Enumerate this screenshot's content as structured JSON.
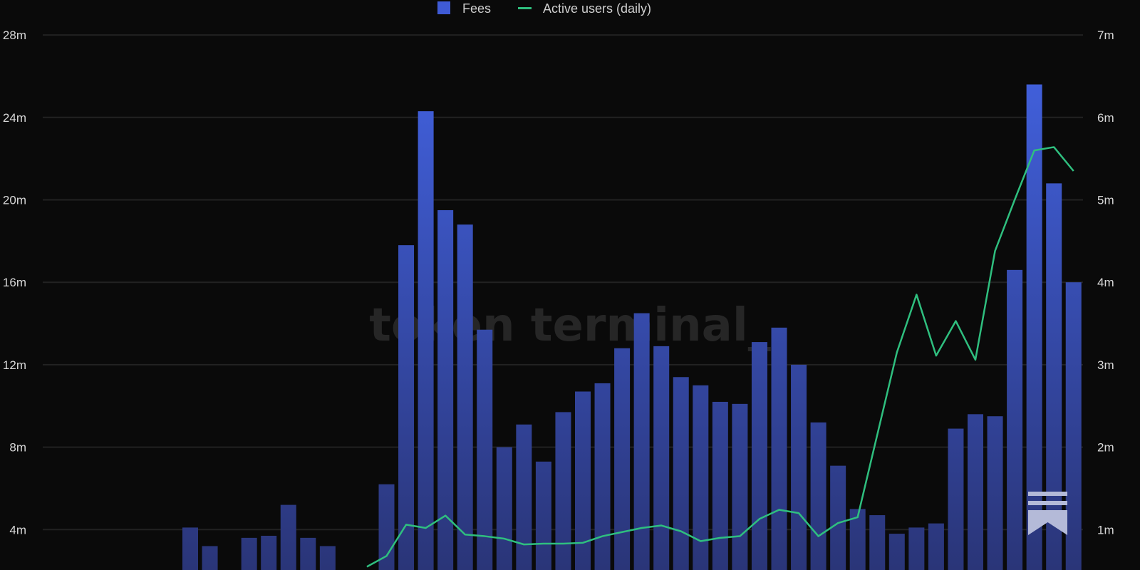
{
  "chart_data": {
    "type": "bar",
    "title": "",
    "watermark": "token terminal_",
    "legend": {
      "placement": "top-center",
      "entries": [
        "Fees",
        "Active users (daily)"
      ]
    },
    "colors": {
      "fees": "#3f5bd6",
      "fees_bottom": "#2a3578",
      "active_users": "#2fbf7f",
      "background": "#0a0a0a",
      "grid": "#222222"
    },
    "left_axis": {
      "label": "Fees",
      "ylim": [
        0,
        28000000
      ],
      "ticks": [
        "4m",
        "8m",
        "12m",
        "16m",
        "20m",
        "24m",
        "28m"
      ],
      "tick_values": [
        4,
        8,
        12,
        16,
        20,
        24,
        28
      ]
    },
    "right_axis": {
      "label": "Active users (daily)",
      "ylim": [
        0,
        7000000
      ],
      "ticks": [
        "1m",
        "2m",
        "3m",
        "4m",
        "5m",
        "6m",
        "7m"
      ],
      "tick_values": [
        1,
        2,
        3,
        4,
        5,
        6,
        7
      ]
    },
    "grid": true,
    "x": [
      0,
      1,
      2,
      3,
      4,
      5,
      6,
      7,
      8,
      9,
      10,
      11,
      12,
      13,
      14,
      15,
      16,
      17,
      18,
      19,
      20,
      21,
      22,
      23,
      24,
      25,
      26,
      27,
      28,
      29,
      30,
      31,
      32,
      33,
      34,
      35,
      36,
      37,
      38,
      39,
      40,
      41,
      42,
      43,
      44,
      45
    ],
    "series": [
      {
        "name": "Fees",
        "axis": "left",
        "unit": "m",
        "values": [
          4.1,
          3.2,
          null,
          3.6,
          3.7,
          5.2,
          3.6,
          3.2,
          null,
          null,
          6.2,
          17.8,
          24.3,
          19.5,
          18.8,
          13.7,
          8.0,
          9.1,
          7.3,
          9.7,
          10.7,
          11.1,
          12.8,
          14.5,
          12.9,
          11.4,
          11.0,
          10.2,
          10.1,
          13.1,
          13.8,
          12.0,
          9.2,
          7.1,
          5.0,
          4.7,
          3.8,
          4.1,
          4.3,
          8.9,
          9.6,
          9.5,
          16.6,
          25.6,
          20.8,
          16.0
        ]
      },
      {
        "name": "Active users (daily)",
        "axis": "right",
        "unit": "m",
        "values": [
          null,
          null,
          null,
          null,
          null,
          null,
          null,
          null,
          null,
          0.55,
          0.68,
          1.06,
          1.02,
          1.17,
          0.94,
          0.92,
          0.89,
          0.82,
          0.83,
          0.83,
          0.84,
          0.92,
          0.97,
          1.02,
          1.05,
          0.98,
          0.86,
          0.9,
          0.92,
          1.13,
          1.24,
          1.2,
          0.92,
          1.08,
          1.15,
          2.15,
          3.15,
          3.85,
          3.11,
          3.53,
          3.06,
          4.38,
          5.0,
          5.6,
          5.64,
          5.35
        ]
      }
    ]
  }
}
